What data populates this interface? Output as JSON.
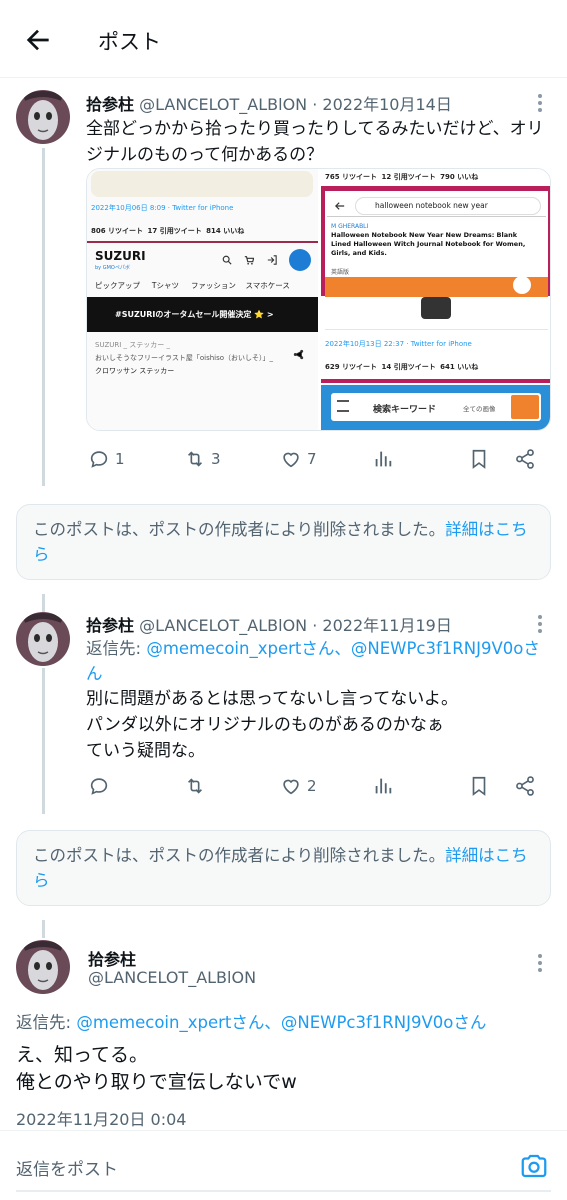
{
  "header": {
    "title": "ポスト",
    "back_icon": "arrow-left-icon"
  },
  "posts": [
    {
      "name": "拾参柱",
      "handle": "@LANCELOT_ALBlON",
      "date": "2022年10月14日",
      "text": "全部どっかから拾ったり買ったりしてるみたいだけど、オリジナルのものって何かあるの？",
      "counts": {
        "reply": "1",
        "repost": "3",
        "like": "7"
      },
      "media": {
        "left": {
          "date": "2022年10月06日 8:09 · Twitter for iPhone",
          "stats": [
            "806 リツイート",
            "17 引用ツイート",
            "814 いいね"
          ],
          "brand": "SUZURI",
          "brand_sub": "by GMOペパボ",
          "nav": [
            "ピックアップ",
            "Tシャツ",
            "ファッション",
            "スマホケース"
          ],
          "banner": "#SUZURIのオータムセール開催決定 ⭐ >",
          "item_line1": "SUZURI _ ステッカー _",
          "item_line2": "おいしそうなフリーイラスト屋「oishiso（おいしそ）」_",
          "item_line3": "クロワッサン ステッカー"
        },
        "right": {
          "top_stats": [
            "765 リツイート",
            "12 引用ツイート",
            "790 いいね"
          ],
          "search_text": "halloween notebook new year",
          "seller": "M GHERABLI",
          "product_title": "Halloween Notebook New Year New Dreams: Blank Lined Halloween Witch Journal Notebook for Women, Girls, and Kids.",
          "format": "英語版",
          "date": "2022年10月13日 22:37 · Twitter for iPhone",
          "stats": [
            "629 リツイート",
            "14 引用ツイート",
            "641 いいね"
          ],
          "search_placeholder": "検索キーワード",
          "filter_option": "全ての画像"
        }
      }
    },
    {
      "name": "拾参柱",
      "handle": "@LANCELOT_ALBlON",
      "date": "2022年11月19日",
      "reply_label": "返信先: ",
      "reply_to": "@memecoin_xpertさん、@NEWPc3f1RNJ9V0oさん",
      "text_lines": [
        "別に問題があるとは思ってないし言ってないよ。",
        "パンダ以外にオリジナルのものがあるのかなぁ",
        "ていう疑問な。"
      ],
      "counts": {
        "like": "2"
      }
    }
  ],
  "deleted_notice": {
    "text": "このポストは、ポストの作成者により削除されました。",
    "link": "詳細はこちら"
  },
  "main_post": {
    "name": "拾参柱",
    "handle": "@LANCELOT_ALBlON",
    "reply_label": "返信先: ",
    "reply_to": "@memecoin_xpertさん、@NEWPc3f1RNJ9V0oさん",
    "text_lines": [
      "え、知ってる。",
      "俺とのやり取りで宣伝しないでw"
    ],
    "timestamp": "2022年11月20日 0:04"
  },
  "composer": {
    "placeholder": "返信をポスト",
    "icon": "camera-icon"
  },
  "colors": {
    "link": "#1d9bf0",
    "muted": "#536471",
    "text": "#0f1419"
  }
}
